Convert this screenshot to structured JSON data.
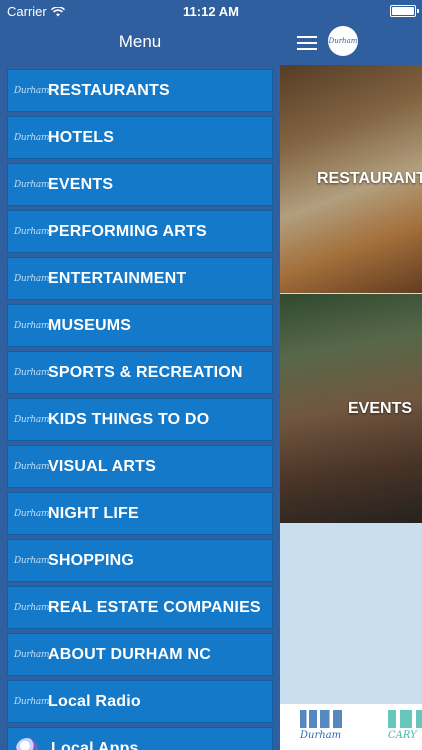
{
  "status_bar": {
    "carrier": "Carrier",
    "time": "11:12 AM"
  },
  "menu": {
    "title": "Menu",
    "logo_text": "Durham",
    "items": [
      {
        "label": "RESTAURANTS"
      },
      {
        "label": "HOTELS"
      },
      {
        "label": "EVENTS"
      },
      {
        "label": "PERFORMING ARTS"
      },
      {
        "label": "ENTERTAINMENT"
      },
      {
        "label": "MUSEUMS"
      },
      {
        "label": "SPORTS & RECREATION"
      },
      {
        "label": "KIDS THINGS TO DO"
      },
      {
        "label": "VISUAL ARTS"
      },
      {
        "label": "NIGHT LIFE"
      },
      {
        "label": "SHOPPING"
      },
      {
        "label": "REAL ESTATE COMPANIES"
      },
      {
        "label": "ABOUT DURHAM NC"
      },
      {
        "label": "Local Radio"
      },
      {
        "label": "Local Apps"
      }
    ]
  },
  "content": {
    "badge_text": "Durham",
    "tiles": [
      {
        "label": "RESTAURANTS"
      },
      {
        "label": "EVENTS"
      }
    ],
    "bottom_tabs": [
      {
        "label": "Durham"
      },
      {
        "label": "CARY"
      }
    ]
  },
  "colors": {
    "panel_bg": "#2f5f9e",
    "menu_item_bg": "#1479c8",
    "accent_teal": "#3fb8a8"
  }
}
